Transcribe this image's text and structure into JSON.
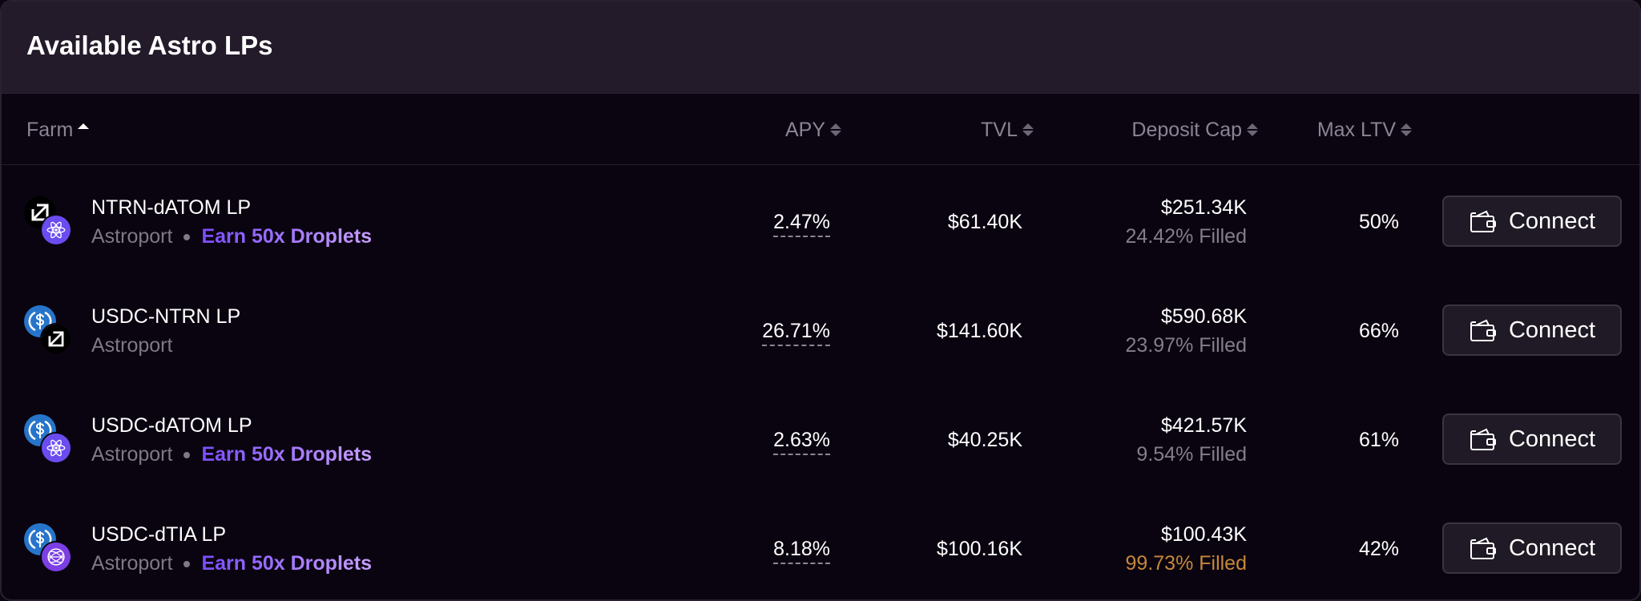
{
  "header": {
    "title": "Available Astro LPs"
  },
  "columns": {
    "farm": "Farm",
    "apy": "APY",
    "tvl": "TVL",
    "deposit_cap": "Deposit Cap",
    "max_ltv": "Max LTV"
  },
  "colors": {
    "accent_gradient_start": "#7a4dff",
    "accent_gradient_end": "#c9a0ff",
    "warning": "#c7873a",
    "usdc": "#2775ca",
    "atom": "#6a4cf0"
  },
  "rows": [
    {
      "name": "NTRN-dATOM LP",
      "source": "Astroport",
      "reward": "Earn 50x Droplets",
      "tokens": [
        "neutron-icon",
        "datom-icon"
      ],
      "apy": "2.47%",
      "tvl": "$61.40K",
      "cap": "$251.34K",
      "filled": "24.42% Filled",
      "ltv": "50%",
      "action": "Connect"
    },
    {
      "name": "USDC-NTRN LP",
      "source": "Astroport",
      "reward": "",
      "tokens": [
        "usdc-icon",
        "neutron-icon"
      ],
      "apy": "26.71%",
      "tvl": "$141.60K",
      "cap": "$590.68K",
      "filled": "23.97% Filled",
      "ltv": "66%",
      "action": "Connect"
    },
    {
      "name": "USDC-dATOM LP",
      "source": "Astroport",
      "reward": "Earn 50x Droplets",
      "tokens": [
        "usdc-icon",
        "datom-icon"
      ],
      "apy": "2.63%",
      "tvl": "$40.25K",
      "cap": "$421.57K",
      "filled": "9.54% Filled",
      "ltv": "61%",
      "action": "Connect"
    },
    {
      "name": "USDC-dTIA LP",
      "source": "Astroport",
      "reward": "Earn 50x Droplets",
      "tokens": [
        "usdc-icon",
        "dtia-icon"
      ],
      "apy": "8.18%",
      "tvl": "$100.16K",
      "cap": "$100.43K",
      "filled": "99.73% Filled",
      "filled_warning": true,
      "ltv": "42%",
      "action": "Connect"
    }
  ]
}
